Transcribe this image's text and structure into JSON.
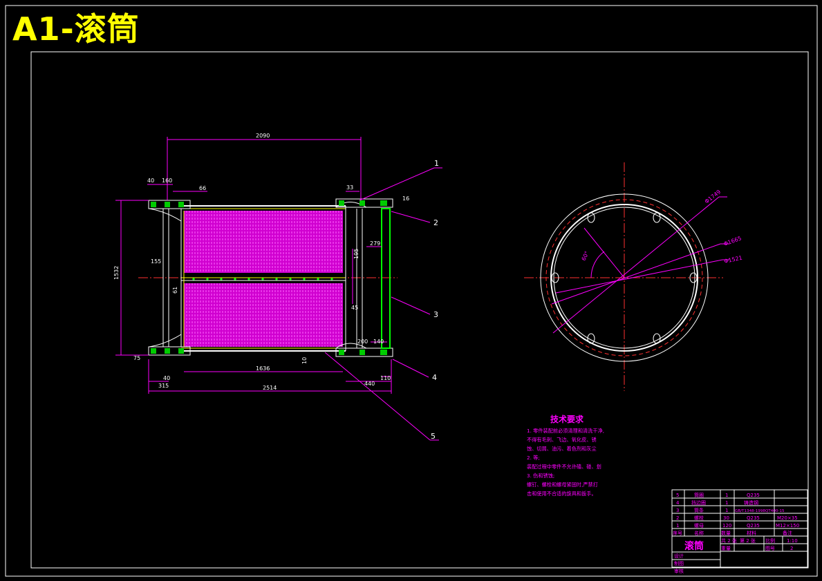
{
  "drawing_title": "A1-滚筒",
  "dimensions": {
    "top_span": "2090",
    "d40": "40",
    "d160": "160",
    "d66": "66",
    "d33": "33",
    "d16": "16",
    "d1532": "1532",
    "d155": "155",
    "d61": "61",
    "d279": "279",
    "d195": "195",
    "d45": "45",
    "d200": "200",
    "d140": "140",
    "d75": "75",
    "d10": "10",
    "d1636": "1636",
    "d40b": "40",
    "d315": "315",
    "d440": "440",
    "d110": "110",
    "d2514": "2514",
    "dia_outer": "Φ1749",
    "dia_mid": "Φ1665",
    "dia_inner": "Φ1521",
    "angle": "60°"
  },
  "callouts": [
    "1",
    "2",
    "3",
    "4",
    "5"
  ],
  "tech_requirements": {
    "heading": "技术要求",
    "lines": [
      "1. 零件装配前必须清理和清洗干净,",
      "   不得有毛刺、飞边、氧化皮、锈",
      "   蚀、切屑、油污、着色剂和灰尘",
      "2. 等;",
      "   装配过程中零件不允许磕、碰、划",
      "3. 伤和锈蚀;",
      "   螺钉、螺栓和螺母紧固时,严禁打",
      "   击和使用不合适的旋具和扳手。"
    ]
  },
  "title_block": {
    "rows": [
      [
        "5",
        "筒圈",
        "1",
        "Q235",
        ""
      ],
      [
        "4",
        "挡边圈",
        "1",
        "铸造钢",
        ""
      ],
      [
        "3",
        "筒条",
        "1",
        "GB/T1348-1998QT400-15",
        ""
      ],
      [
        "2",
        "螺栓",
        "30",
        "Q235",
        "M20×35"
      ],
      [
        "1",
        "螺母",
        "120",
        "Q235",
        "M12×150"
      ]
    ],
    "header": [
      "序号",
      "名称",
      "数量",
      "材料",
      "备注"
    ],
    "name": "滚筒",
    "total_label": "共 2 张",
    "sheet_label": "第 2 张",
    "scale_label": "比例",
    "scale_value": "1:10",
    "weight_label": "重量",
    "drawing_no_label": "图号",
    "drawing_no_value": "2",
    "design_label": "设计",
    "draw_label": "制图",
    "review_label": "审核"
  }
}
